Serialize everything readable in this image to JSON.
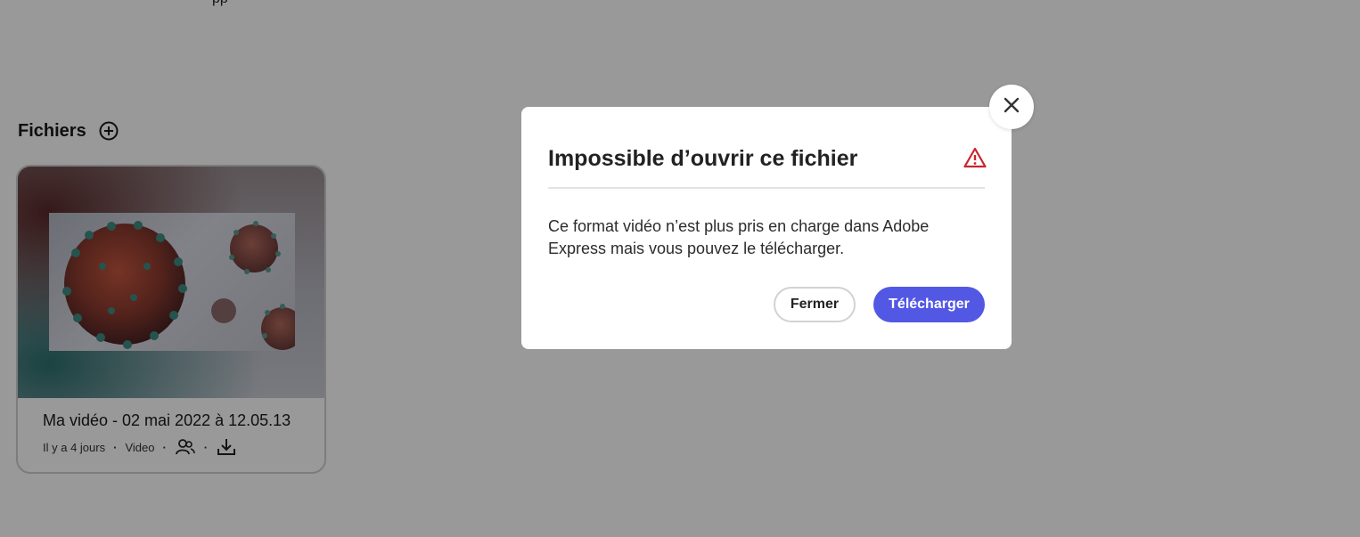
{
  "page": {
    "section_title": "Fichiers",
    "top_cut_text": "pp"
  },
  "file_card": {
    "title": "Ma vidéo - 02 mai 2022 à 12.05.13",
    "time_ago": "Il y a 4 jours",
    "type": "Video",
    "icons": [
      "add-circle-icon",
      "shared-users-icon",
      "download-icon"
    ]
  },
  "dialog": {
    "title": "Impossible d’ouvrir ce fichier",
    "message": "Ce format vidéo n’est plus pris en charge dans Adobe Express mais vous pouvez le télécharger.",
    "close_label": "Fermer",
    "download_label": "Télécharger",
    "icons": [
      "warning-icon",
      "close-icon"
    ]
  },
  "colors": {
    "primary": "#5258e4",
    "warning": "#c9252d",
    "overlay": "rgba(0,0,0,0.4)"
  }
}
